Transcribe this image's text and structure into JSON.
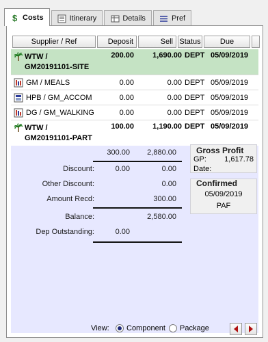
{
  "tabs": [
    {
      "label": "Costs",
      "icon": "dollar-icon",
      "active": true
    },
    {
      "label": "Itinerary",
      "icon": "list-icon"
    },
    {
      "label": "Details",
      "icon": "table-icon"
    },
    {
      "label": "Pref",
      "icon": "lines-icon"
    }
  ],
  "columns": {
    "supplier": "Supplier / Ref",
    "deposit": "Deposit",
    "sell": "Sell",
    "status": "Status",
    "due": "Due"
  },
  "rows": [
    {
      "icon": "palm-tree-icon",
      "ref_line1": "WTW /",
      "ref_line2": "GM20191101-SITE",
      "deposit": "200.00",
      "sell": "1,690.00",
      "status": "DEPT",
      "due": "05/09/2019"
    },
    {
      "icon": "meals-icon",
      "ref_line1": "GM  / MEALS",
      "deposit": "0.00",
      "sell": "0.00",
      "status": "DEPT",
      "due": "05/09/2019"
    },
    {
      "icon": "accommodation-icon",
      "ref_line1": "HPB / GM_ACCOM",
      "deposit": "0.00",
      "sell": "0.00",
      "status": "DEPT",
      "due": "05/09/2019"
    },
    {
      "icon": "walking-icon",
      "ref_line1": "DG  / GM_WALKING",
      "deposit": "0.00",
      "sell": "0.00",
      "status": "DEPT",
      "due": "05/09/2019"
    },
    {
      "icon": "palm-tree-icon",
      "ref_line1": "WTW /",
      "ref_line2": "GM20191101-PART",
      "deposit": "100.00",
      "sell": "1,190.00",
      "status": "DEPT",
      "due": "05/09/2019"
    }
  ],
  "totals": {
    "deposit": "300.00",
    "sell": "2,880.00"
  },
  "summary": {
    "discount_label": "Discount:",
    "discount_deposit": "0.00",
    "discount_sell": "0.00",
    "other_discount_label": "Other Discount:",
    "other_discount_sell": "0.00",
    "amount_recd_label": "Amount Recd:",
    "amount_recd_sell": "300.00",
    "balance_label": "Balance:",
    "balance_sell": "2,580.00",
    "dep_outstanding_label": "Dep Outstanding:",
    "dep_outstanding_deposit": "0.00"
  },
  "gross_profit": {
    "title": "Gross Profit",
    "gp_label": "GP:",
    "gp_value": "1,617.78",
    "date_label": "Date:"
  },
  "confirmed": {
    "title": "Confirmed",
    "date": "05/09/2019",
    "by": "PAF"
  },
  "footer": {
    "view_label": "View:",
    "component_label": "Component",
    "package_label": "Package",
    "selected": "Component"
  },
  "colors": {
    "selected_row": "#c5e3c4",
    "summary_bg": "#e7e8ff",
    "accent": "#1f2a7a"
  }
}
